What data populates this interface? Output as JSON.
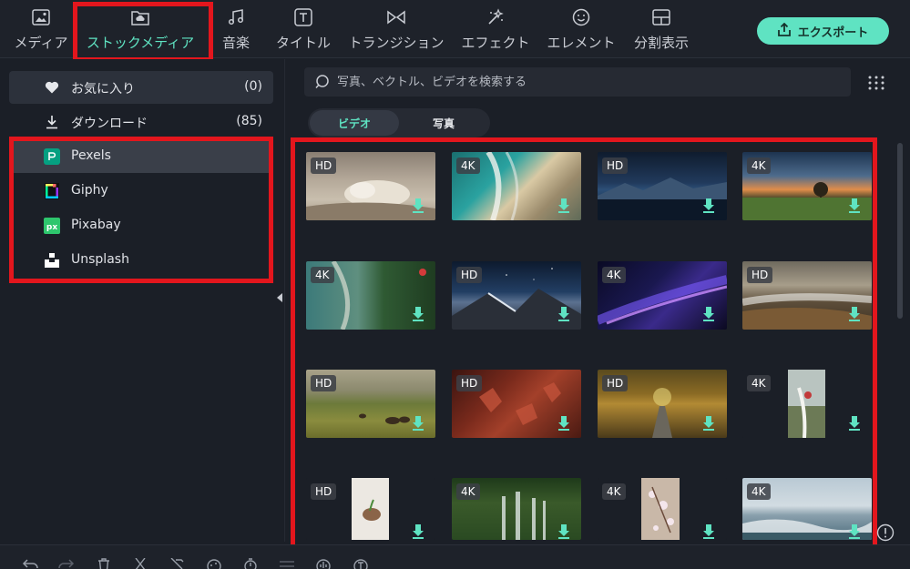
{
  "toolbar": {
    "tabs": [
      {
        "label": "メディア"
      },
      {
        "label": "ストックメディア"
      },
      {
        "label": "音楽"
      },
      {
        "label": "タイトル"
      },
      {
        "label": "トランジション"
      },
      {
        "label": "エフェクト"
      },
      {
        "label": "エレメント"
      },
      {
        "label": "分割表示"
      }
    ],
    "export_label": "エクスポート"
  },
  "sidebar": {
    "items": [
      {
        "label": "お気に入り",
        "count": "(0)"
      },
      {
        "label": "ダウンロード",
        "count": "(85)"
      },
      {
        "label": "Pexels"
      },
      {
        "label": "Giphy"
      },
      {
        "label": "Pixabay"
      },
      {
        "label": "Unsplash"
      }
    ]
  },
  "search": {
    "placeholder": "写真、ベクトル、ビデオを検索する"
  },
  "media_type": {
    "options": [
      "ビデオ",
      "写真"
    ],
    "selected": "ビデオ"
  },
  "thumbnails": [
    {
      "badge": "HD"
    },
    {
      "badge": "4K"
    },
    {
      "badge": "HD"
    },
    {
      "badge": "4K"
    },
    {
      "badge": "4K"
    },
    {
      "badge": "HD"
    },
    {
      "badge": "4K"
    },
    {
      "badge": "HD"
    },
    {
      "badge": "HD"
    },
    {
      "badge": "HD"
    },
    {
      "badge": "HD"
    },
    {
      "badge": "4K"
    },
    {
      "badge": "HD"
    },
    {
      "badge": "4K"
    },
    {
      "badge": "4K"
    },
    {
      "badge": "4K"
    }
  ],
  "colors": {
    "accent": "#5fe3c2",
    "highlight": "#e3161d",
    "background": "#1b1f27"
  }
}
